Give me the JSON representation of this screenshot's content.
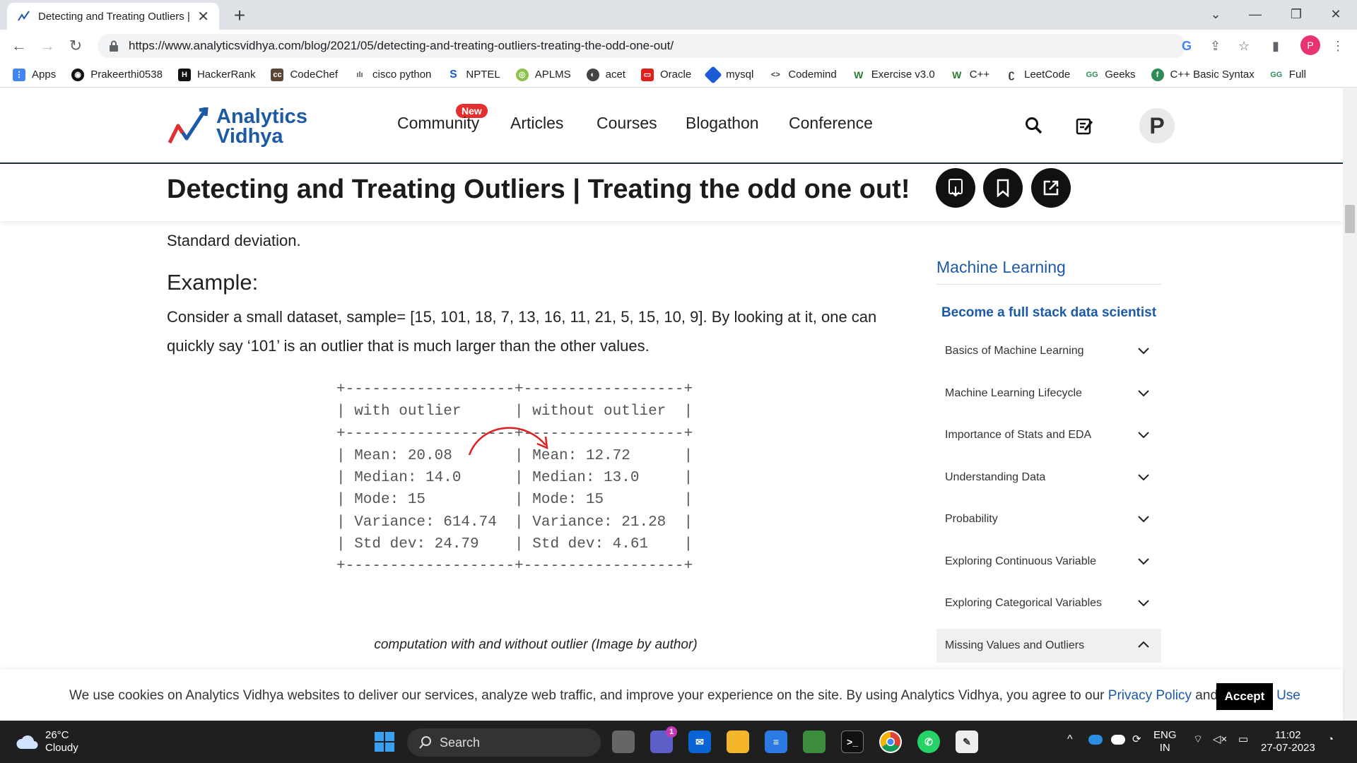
{
  "browser": {
    "tab_title": "Detecting and Treating Outliers |",
    "url": "https://www.analyticsvidhya.com/blog/2021/05/detecting-and-treating-outliers-treating-the-odd-one-out/",
    "profile_initial": "P",
    "bookmarks": [
      "Apps",
      "Prakeerthi0538",
      "HackerRank",
      "CodeChef",
      "cisco python",
      "NPTEL",
      "APLMS",
      "acet",
      "Oracle",
      "mysql",
      "Codemind",
      "Exercise v3.0",
      "C++",
      "LeetCode",
      "Geeks",
      "C++ Basic Syntax",
      "Full"
    ]
  },
  "site": {
    "logo_line1": "Analytics",
    "logo_line2": "Vidhya",
    "nav": [
      "Community",
      "Articles",
      "Courses",
      "Blogathon",
      "Conference"
    ],
    "new_badge": "New",
    "avatar_initial": "P"
  },
  "article": {
    "title": "Detecting and Treating Outliers | Treating the odd one out!",
    "intro_fragment": "Standard deviation.",
    "example_heading": "Example:",
    "paragraph_line1": "Consider a small dataset, sample= [15, 101, 18, 7, 13, 16, 11, 21, 5, 15, 10, 9]. By looking at it, one can",
    "paragraph_line2": "quickly say ‘101’ is an outlier that is much larger than the other values.",
    "figure_text": "+-------------------+------------------+\n| with outlier      | without outlier  |\n+-------------------+------------------+\n| Mean: 20.08       | Mean: 12.72      |\n| Median: 14.0      | Median: 13.0     |\n| Mode: 15          | Mode: 15         |\n| Variance: 614.74  | Variance: 21.28  |\n| Std dev: 24.79    | Std dev: 4.61    |\n+-------------------+------------------+",
    "caption": "computation with and without outlier (Image by author)"
  },
  "sidebar": {
    "title": "Machine Learning",
    "cta": "Become a full stack data scientist",
    "items": [
      {
        "label": "Basics of Machine Learning",
        "expanded": false
      },
      {
        "label": "Machine Learning Lifecycle",
        "expanded": false
      },
      {
        "label": "Importance of Stats and EDA",
        "expanded": false
      },
      {
        "label": "Understanding Data",
        "expanded": false
      },
      {
        "label": "Probability",
        "expanded": false
      },
      {
        "label": "Exploring Continuous Variable",
        "expanded": false
      },
      {
        "label": "Exploring Categorical Variables",
        "expanded": false
      },
      {
        "label": "Missing Values and Outliers",
        "expanded": true
      }
    ]
  },
  "cookie": {
    "text": "We use cookies on Analytics Vidhya websites to deliver our services, analyze web traffic, and improve your experience on the site. By using Analytics Vidhya, you agree to our ",
    "privacy": "Privacy Policy",
    "and": " and ",
    "terms": "Terms of Use",
    "accept": "Accept"
  },
  "taskbar": {
    "temperature": "26°C",
    "condition": "Cloudy",
    "search": "Search",
    "lang_line1": "ENG",
    "lang_line2": "IN",
    "time": "11:02",
    "date": "27-07-2023",
    "teams_badge": "1"
  },
  "colors": {
    "brand_blue": "#1c5aa6",
    "badge_red": "#e42f2f",
    "arrow_red": "#e0201f"
  }
}
